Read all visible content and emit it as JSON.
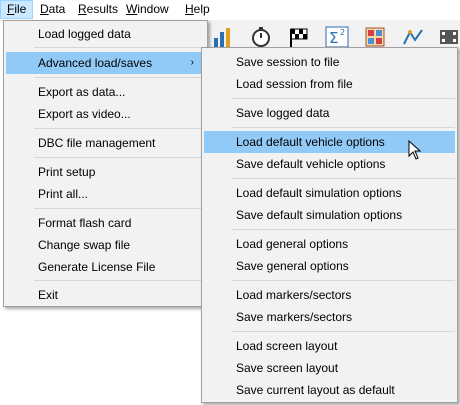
{
  "menubar": {
    "items": [
      {
        "label": "File",
        "mnemonic": "F",
        "rest": "ile"
      },
      {
        "label": "Data",
        "mnemonic": "D",
        "rest": "ata"
      },
      {
        "label": "Results",
        "mnemonic": "R",
        "rest": "esults"
      },
      {
        "label": "Window",
        "mnemonic": "W",
        "rest": "indow"
      },
      {
        "label": "Help",
        "mnemonic": "H",
        "rest": "elp"
      }
    ]
  },
  "toolbar": {
    "icons": [
      "bar-chart-icon",
      "stopwatch-icon",
      "checkered-flag-icon",
      "sigma-squared-icon",
      "calculator-icon",
      "track-map-icon",
      "film-icon"
    ]
  },
  "file_menu": {
    "items": [
      {
        "label": "Load logged data"
      },
      {
        "label": "Advanced load/saves",
        "has_submenu": true
      },
      {
        "label": "Export as data..."
      },
      {
        "label": "Export as video..."
      },
      {
        "label": "DBC file management"
      },
      {
        "label": "Print setup"
      },
      {
        "label": "Print all..."
      },
      {
        "label": "Format flash card"
      },
      {
        "label": "Change swap file"
      },
      {
        "label": "Generate License File"
      },
      {
        "label": "Exit"
      }
    ],
    "submenu_arrow": "›"
  },
  "submenu": {
    "items": [
      {
        "label": "Save session to file"
      },
      {
        "label": "Load session from file"
      },
      {
        "label": "Save logged data"
      },
      {
        "label": "Load default vehicle options"
      },
      {
        "label": "Save default vehicle options"
      },
      {
        "label": "Load default simulation options"
      },
      {
        "label": "Save default simulation options"
      },
      {
        "label": "Load general options"
      },
      {
        "label": "Save general options"
      },
      {
        "label": "Load markers/sectors"
      },
      {
        "label": "Save markers/sectors"
      },
      {
        "label": "Load screen layout"
      },
      {
        "label": "Save screen layout"
      },
      {
        "label": "Save current layout as default"
      }
    ]
  },
  "colors": {
    "highlight": "#91c9f7",
    "active_menubar": "#cce8ff",
    "menu_bg": "#f2f2f2"
  }
}
